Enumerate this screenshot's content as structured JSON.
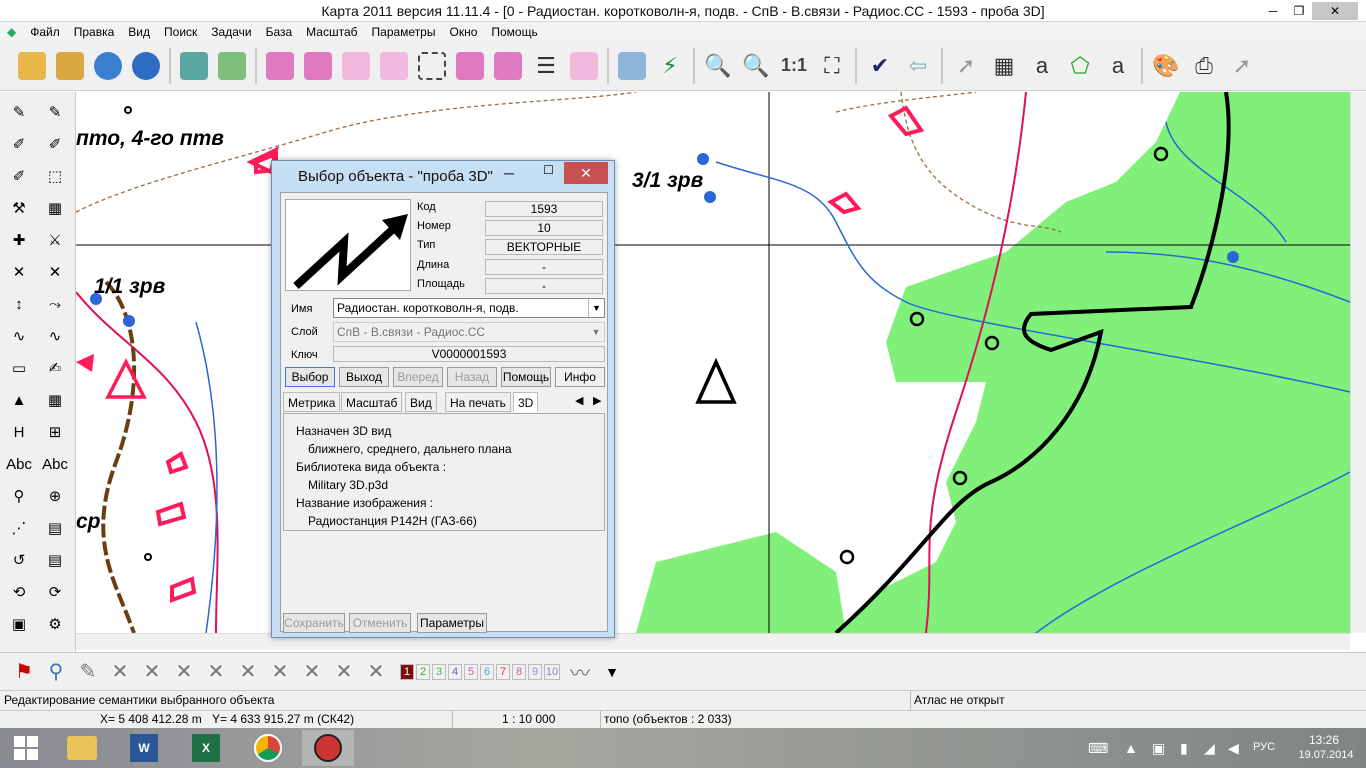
{
  "window": {
    "title": "Карта 2011 версия 11.11.4 - [0 - Радиостан. коротковолн-я, подв. - СпВ - В.связи - Радиос.СС - 1593 - проба 3D]"
  },
  "menu": [
    "Файл",
    "Правка",
    "Вид",
    "Поиск",
    "Задачи",
    "База",
    "Масштаб",
    "Параметры",
    "Окно",
    "Помощь"
  ],
  "toolbar": {
    "scale_label": "1:1"
  },
  "map_labels": {
    "l1": "пто, 4-го птв",
    "l2": "3/1 зрв",
    "l3": "1/1 зрв",
    "l4": "ср"
  },
  "dialog": {
    "title": "Выбор объекта - \"проба 3D\"",
    "kod_label": "Код",
    "kod": "1593",
    "nomer_label": "Номер",
    "nomer": "10",
    "tip_label": "Тип",
    "tip": "ВЕКТОРНЫЕ",
    "dlina_label": "Длина",
    "dlina": "-",
    "ploshad_label": "Площадь",
    "ploshad": "-",
    "imya_label": "Имя",
    "imya": "Радиостан. коротковолн-я, подв.",
    "sloi_label": "Слой",
    "sloi": "СпВ - В.связи - Радиос.СС",
    "klyuch_label": "Ключ",
    "klyuch": "V0000001593",
    "buttons": {
      "vybor": "Выбор",
      "vyhod": "Выход",
      "vpered": "Вперед",
      "nazad": "Назад",
      "pomosh": "Помощь",
      "info": "Инфо"
    },
    "tabs": [
      "Метрика",
      "Масштаб",
      "Вид",
      "На печать",
      "3D"
    ],
    "info_lines": [
      "Назначен 3D вид",
      "ближнего, среднего, дальнего плана",
      "Библиотека вида объекта :",
      "Military 3D.p3d",
      "Название изображения :",
      "Радиостанция Р142Н (ГАЗ-66)"
    ],
    "bottom_buttons": {
      "save": "Сохранить",
      "cancel": "Отменить",
      "params": "Параметры"
    }
  },
  "layer_numbers": [
    "1",
    "2",
    "3",
    "4",
    "5",
    "6",
    "7",
    "8",
    "9",
    "10"
  ],
  "status": {
    "message": "Редактирование семантики выбранного объекта",
    "atlas": "Атлас не открыт",
    "coords_x": "X= 5 408 412.28 m",
    "coords_y": "Y= 4 633 915.27 m  (СК42)",
    "scale": "1 : 10 000",
    "topo": "топо   (объектов : 2 033)"
  },
  "taskbar": {
    "lang": "РУС",
    "time": "13:26",
    "date": "19.07.2014"
  },
  "colors": {
    "green_area": "#80f07a",
    "red": "#ff1a5a",
    "brown": "#6b3e12"
  }
}
